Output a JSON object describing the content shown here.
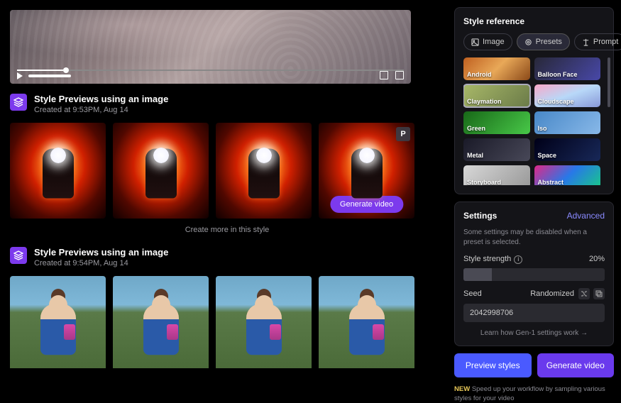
{
  "section1": {
    "title": "Style Previews using an image",
    "sub": "Created at 9:53PM, Aug 14",
    "p_tag": "P",
    "generate": "Generate video",
    "more": "Create more in this style"
  },
  "section2": {
    "title": "Style Previews using an image",
    "sub": "Created at 9:54PM, Aug 14"
  },
  "style_ref": {
    "title": "Style reference",
    "tabs": {
      "image": "Image",
      "presets": "Presets",
      "prompt": "Prompt"
    },
    "presets": [
      {
        "label": "Android",
        "cls": "p-android"
      },
      {
        "label": "Balloon Face",
        "cls": "p-balloon"
      },
      {
        "label": "Claymation",
        "cls": "p-claym",
        "sel": true
      },
      {
        "label": "Cloudscape",
        "cls": "p-cloud"
      },
      {
        "label": "Green",
        "cls": "p-green"
      },
      {
        "label": "Iso",
        "cls": "p-iso"
      },
      {
        "label": "Metal",
        "cls": "p-metal"
      },
      {
        "label": "Space",
        "cls": "p-space"
      },
      {
        "label": "Storyboard",
        "cls": "p-story"
      },
      {
        "label": "Abstract",
        "cls": "p-abstract"
      }
    ]
  },
  "settings": {
    "title": "Settings",
    "advanced": "Advanced",
    "note": "Some settings may be disabled when a preset is selected.",
    "strength_label": "Style strength",
    "strength_value": "20%",
    "seed_label": "Seed",
    "seed_mode": "Randomized",
    "seed_value": "2042998706",
    "learn": "Learn how Gen-1 settings work"
  },
  "actions": {
    "preview": "Preview styles",
    "generate": "Generate video",
    "new": "NEW",
    "tip": "Speed up your workflow by sampling various styles for your video"
  }
}
